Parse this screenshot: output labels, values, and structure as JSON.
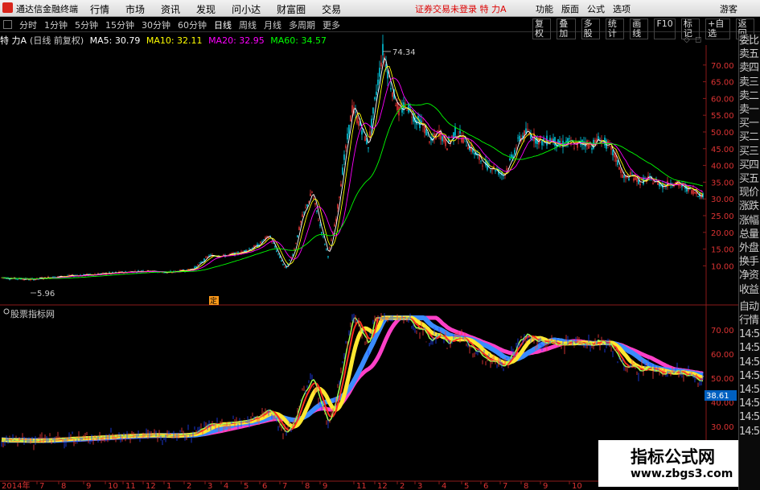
{
  "app": {
    "name": "通达信金融终端",
    "menus": [
      "行情",
      "市场",
      "资讯",
      "发现",
      "问小达",
      "财富圈",
      "交易"
    ],
    "status": "证券交易未登录  特 力A",
    "right_menus": [
      "功能",
      "版面",
      "公式",
      "选项"
    ],
    "guest": "游客"
  },
  "periods": {
    "items": [
      "分时",
      "1分钟",
      "5分钟",
      "15分钟",
      "30分钟",
      "60分钟",
      "日线",
      "周线",
      "月线",
      "多周期",
      "更多"
    ],
    "active": "日线"
  },
  "toolbar": [
    "复权",
    "叠加",
    "多股",
    "统计",
    "画线",
    "F10",
    "标记",
    "+自选",
    "返回"
  ],
  "main_chart": {
    "stock": "特 力A",
    "adjust": "(日线 前复权)",
    "ma5_label": "MA5: 30.79",
    "ma10_label": "MA10: 32.11",
    "ma20_label": "MA20: 32.95",
    "ma60_label": "MA60: 34.57",
    "max_label": "74.34",
    "min_label": "5.96",
    "marker": "定"
  },
  "sub_chart": {
    "title": "股票指标网",
    "value_label": "38.61"
  },
  "right_panel": [
    "委比",
    "卖五",
    "卖四",
    "卖三",
    "卖二",
    "卖一",
    "买一",
    "买二",
    "买三",
    "买四",
    "买五",
    "现价",
    "涨跌",
    "涨幅",
    "总量",
    "外盘",
    "换手",
    "净资",
    "收益"
  ],
  "right_panel_sub": [
    "自动",
    "行情",
    "14:5",
    "14:5",
    "14:5",
    "14:5",
    "14:5",
    "14:5",
    "14:5",
    "14:5"
  ],
  "x_axis": {
    "year_label": "2014年",
    "ticks": [
      "7",
      "8",
      "9",
      "10",
      "11",
      "12",
      "1",
      "2",
      "3",
      "4",
      "5",
      "6",
      "7",
      "8",
      "9",
      "11",
      "12",
      "2",
      "3",
      "4",
      "5",
      "6",
      "7",
      "8",
      "9",
      "10"
    ]
  },
  "watermark": {
    "line1": "指标公式网",
    "line2": "www.zbgs3.com"
  },
  "colors": {
    "up": "#ff3c3c",
    "down": "#00e5ff",
    "ma5": "#ffffff",
    "ma10": "#ffff00",
    "ma20": "#ff00ff",
    "ma60": "#00ff00"
  },
  "chart_data": {
    "type": "candlestick",
    "y_axis_main": [
      10,
      15,
      20,
      25,
      30,
      35,
      40,
      45,
      50,
      55,
      60,
      65,
      70
    ],
    "y_axis_sub": [
      30,
      40,
      50,
      60,
      70
    ],
    "ylim_main": [
      0,
      75
    ],
    "price_path": [
      [
        0,
        6.5
      ],
      [
        20,
        6.2
      ],
      [
        40,
        5.96
      ],
      [
        60,
        6.5
      ],
      [
        90,
        7.0
      ],
      [
        120,
        7.5
      ],
      [
        150,
        8.0
      ],
      [
        180,
        8.5
      ],
      [
        210,
        8.0
      ],
      [
        240,
        9.0
      ],
      [
        260,
        13
      ],
      [
        280,
        13
      ],
      [
        300,
        14
      ],
      [
        320,
        16
      ],
      [
        335,
        19
      ],
      [
        345,
        14
      ],
      [
        355,
        9
      ],
      [
        365,
        14
      ],
      [
        375,
        24
      ],
      [
        388,
        32
      ],
      [
        398,
        22
      ],
      [
        408,
        13
      ],
      [
        418,
        24
      ],
      [
        428,
        42
      ],
      [
        438,
        57
      ],
      [
        448,
        52
      ],
      [
        458,
        46
      ],
      [
        468,
        62
      ],
      [
        476,
        74.34
      ],
      [
        486,
        64
      ],
      [
        496,
        56
      ],
      [
        506,
        58
      ],
      [
        516,
        54
      ],
      [
        526,
        52
      ],
      [
        536,
        47
      ],
      [
        546,
        50
      ],
      [
        556,
        46
      ],
      [
        566,
        50
      ],
      [
        576,
        48
      ],
      [
        586,
        45
      ],
      [
        596,
        42
      ],
      [
        606,
        40
      ],
      [
        616,
        39
      ],
      [
        626,
        37
      ],
      [
        636,
        42
      ],
      [
        646,
        48
      ],
      [
        656,
        50
      ],
      [
        666,
        48
      ],
      [
        676,
        47
      ],
      [
        686,
        48
      ],
      [
        696,
        46
      ],
      [
        706,
        47
      ],
      [
        716,
        46
      ],
      [
        726,
        47
      ],
      [
        736,
        46
      ],
      [
        746,
        48
      ],
      [
        756,
        46
      ],
      [
        766,
        42
      ],
      [
        776,
        36
      ],
      [
        786,
        37
      ],
      [
        796,
        35
      ],
      [
        806,
        36
      ],
      [
        816,
        35
      ],
      [
        826,
        34
      ],
      [
        836,
        35
      ],
      [
        846,
        34
      ],
      [
        856,
        33
      ],
      [
        866,
        32
      ],
      [
        874,
        30.8
      ]
    ]
  }
}
